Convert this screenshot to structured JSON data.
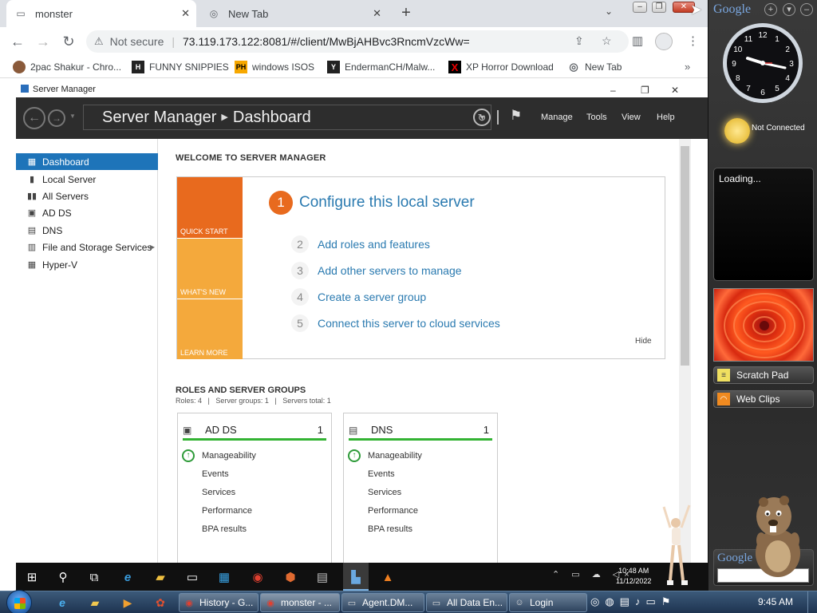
{
  "chrome": {
    "tabs": [
      {
        "title": "monster",
        "active": true
      },
      {
        "title": "New Tab",
        "active": false
      }
    ],
    "toolbar": {
      "security_label": "Not secure",
      "url": "73.119.173.122:8081/#/client/MwBjAHBvc3RncmVzcWw="
    },
    "bookmarks": [
      {
        "label": "2pac Shakur - Chro...",
        "icon": "tupac-icon"
      },
      {
        "label": "FUNNY SNIPPIES",
        "icon": "h-icon"
      },
      {
        "label": "windows ISOS",
        "icon": "ph-icon"
      },
      {
        "label": "EndermanCH/Malw...",
        "icon": "yt-icon"
      },
      {
        "label": "XP Horror Download",
        "icon": "x-icon"
      },
      {
        "label": "New Tab",
        "icon": "globe-icon"
      }
    ],
    "bookmarks_more": "»"
  },
  "server_manager": {
    "window_title": "Server Manager",
    "breadcrumb": {
      "root": "Server Manager",
      "page": "Dashboard"
    },
    "menus": [
      "Manage",
      "Tools",
      "View",
      "Help"
    ],
    "nav": [
      {
        "label": "Dashboard",
        "selected": true,
        "icon": "dashboard-icon"
      },
      {
        "label": "Local Server",
        "selected": false,
        "icon": "server-icon"
      },
      {
        "label": "All Servers",
        "selected": false,
        "icon": "servers-icon"
      },
      {
        "label": "AD DS",
        "selected": false,
        "icon": "ad-ds-icon"
      },
      {
        "label": "DNS",
        "selected": false,
        "icon": "dns-icon"
      },
      {
        "label": "File and Storage Services",
        "selected": false,
        "icon": "storage-icon",
        "expandable": true
      },
      {
        "label": "Hyper-V",
        "selected": false,
        "icon": "hyperv-icon"
      }
    ],
    "welcome": {
      "title": "WELCOME TO SERVER MANAGER",
      "tiles": [
        "QUICK START",
        "WHAT'S NEW",
        "LEARN MORE"
      ],
      "main_step": {
        "num": "1",
        "label": "Configure this local server"
      },
      "steps": [
        {
          "num": "2",
          "label": "Add roles and features"
        },
        {
          "num": "3",
          "label": "Add other servers to manage"
        },
        {
          "num": "4",
          "label": "Create a server group"
        },
        {
          "num": "5",
          "label": "Connect this server to cloud services"
        }
      ],
      "hide_label": "Hide"
    },
    "roles": {
      "title": "ROLES AND SERVER GROUPS",
      "summary": "Roles: 4   |   Server groups: 1   |   Servers total: 1",
      "cards": [
        {
          "name": "AD DS",
          "count": "1",
          "items": [
            "Manageability",
            "Events",
            "Services",
            "Performance",
            "BPA results"
          ]
        },
        {
          "name": "DNS",
          "count": "1",
          "items": [
            "Manageability",
            "Events",
            "Services",
            "Performance",
            "BPA results"
          ]
        }
      ]
    },
    "taskbar_clock": {
      "time": "10:48 AM",
      "date": "11/12/2022"
    }
  },
  "gadgets": {
    "google_label": "Google",
    "weather_status": "Not Connected",
    "loading_label": "Loading...",
    "items": [
      {
        "label": "Scratch Pad",
        "icon": "note-icon"
      },
      {
        "label": "Web Clips",
        "icon": "rss-icon"
      }
    ],
    "clock_numbers": [
      "12",
      "1",
      "2",
      "3",
      "4",
      "5",
      "6",
      "7",
      "8",
      "9",
      "10",
      "11"
    ]
  },
  "win7_taskbar": {
    "tasks": [
      {
        "label": "History - G...",
        "icon": "chrome-icon"
      },
      {
        "label": "monster - ...",
        "icon": "chrome-icon"
      },
      {
        "label": "Agent.DM...",
        "icon": "window-icon"
      },
      {
        "label": "All Data En...",
        "icon": "window-icon"
      },
      {
        "label": "Login",
        "icon": "user-icon"
      }
    ],
    "clock": "9:45 AM"
  },
  "colors": {
    "sm_header": "#2d2d2d",
    "nav_selected": "#1e74b9",
    "quick_start": "#e86a1e",
    "tile_orange": "#f4a93c",
    "link_blue": "#2a7ab0",
    "status_green": "#33b333"
  }
}
